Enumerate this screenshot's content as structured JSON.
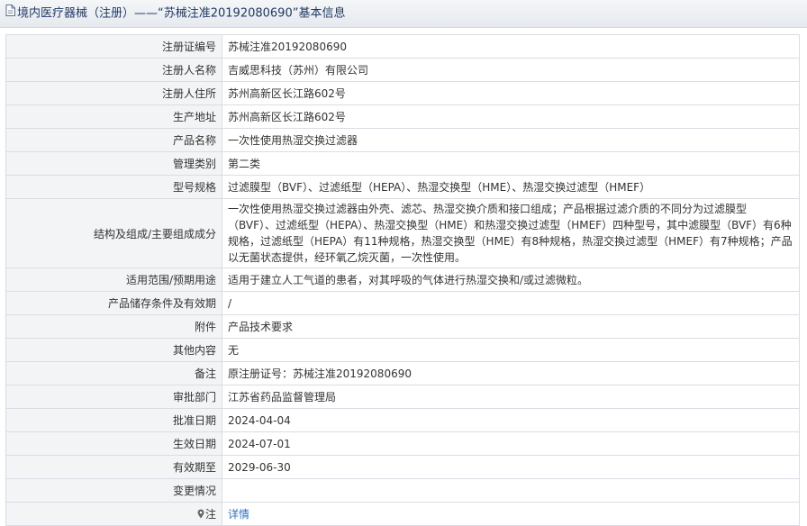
{
  "header": {
    "title": "境内医疗器械（注册）——“苏械注准20192080690”基本信息"
  },
  "rows": [
    {
      "label": "注册证编号",
      "value": "苏械注准20192080690"
    },
    {
      "label": "注册人名称",
      "value": "吉威思科技（苏州）有限公司"
    },
    {
      "label": "注册人住所",
      "value": "苏州高新区长江路602号"
    },
    {
      "label": "生产地址",
      "value": "苏州高新区长江路602号"
    },
    {
      "label": "产品名称",
      "value": "一次性使用热湿交换过滤器"
    },
    {
      "label": "管理类别",
      "value": "第二类"
    },
    {
      "label": "型号规格",
      "value": "过滤膜型（BVF）、过滤纸型（HEPA）、热湿交换型（HME）、热湿交换过滤型（HMEF）"
    },
    {
      "label": "结构及组成/主要组成成分",
      "value": "一次性使用热湿交换过滤器由外壳、滤芯、热湿交换介质和接口组成；产品根据过滤介质的不同分为过滤膜型（BVF）、过滤纸型（HEPA）、热湿交换型（HME）和热湿交换过滤型（HMEF）四种型号，其中滤膜型（BVF）有6种规格，过滤纸型（HEPA）有11种规格，热湿交换型（HME）有8种规格，热湿交换过滤型（HMEF）有7种规格；产品以无菌状态提供，经环氧乙烷灭菌，一次性使用。"
    },
    {
      "label": "适用范围/预期用途",
      "value": "适用于建立人工气道的患者，对其呼吸的气体进行热湿交换和/或过滤微粒。"
    },
    {
      "label": "产品储存条件及有效期",
      "value": "/"
    },
    {
      "label": "附件",
      "value": "产品技术要求"
    },
    {
      "label": "其他内容",
      "value": "无"
    },
    {
      "label": "备注",
      "value": "原注册证号：苏械注准20192080690"
    },
    {
      "label": "审批部门",
      "value": "江苏省药品监督管理局"
    },
    {
      "label": "批准日期",
      "value": "2024-04-04"
    },
    {
      "label": "生效日期",
      "value": "2024-07-01"
    },
    {
      "label": "有效期至",
      "value": "2029-06-30"
    },
    {
      "label": "变更情况",
      "value": ""
    },
    {
      "label": "注",
      "value": "详情"
    }
  ],
  "colors": {
    "link": "#2b73c4",
    "title": "#1f3a66",
    "label_bg": "#f3f4f6",
    "border": "#d9dde3"
  },
  "icons": {
    "title_icon": "document-icon",
    "note_icon": "pin-icon"
  }
}
